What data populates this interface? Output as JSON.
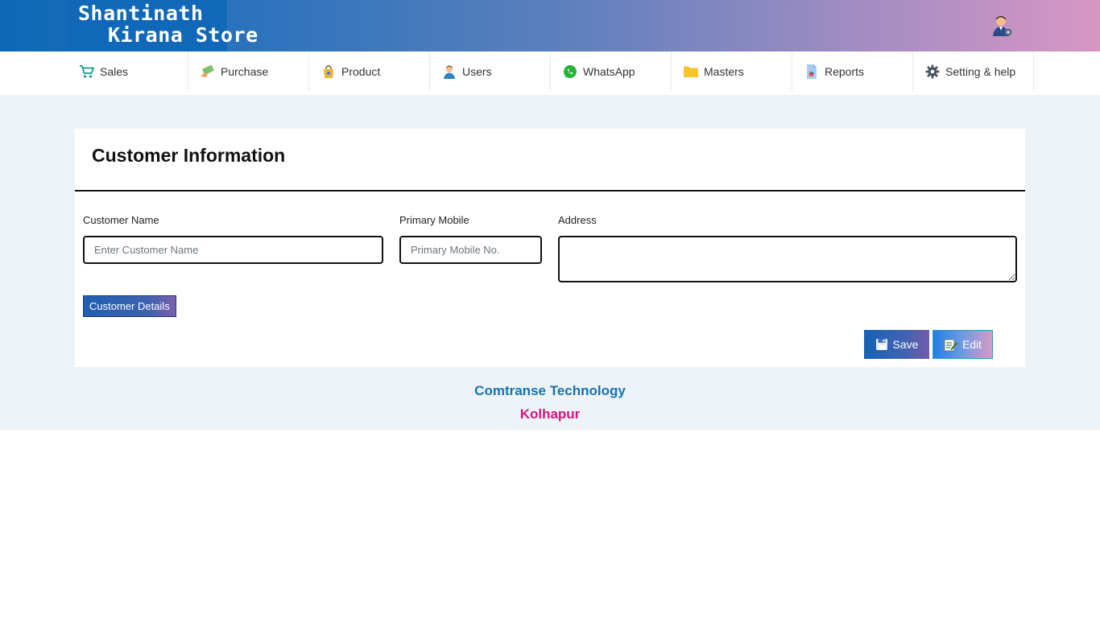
{
  "header": {
    "logo_line1": "Shantinath",
    "logo_line2": "Kirana Store",
    "user_icon": "user-avatar-icon"
  },
  "nav": {
    "items": [
      {
        "label": "Sales",
        "icon": "cart-icon"
      },
      {
        "label": "Purchase",
        "icon": "cash-icon"
      },
      {
        "label": "Product",
        "icon": "product-bag-icon"
      },
      {
        "label": "Users",
        "icon": "user-icon"
      },
      {
        "label": "WhatsApp",
        "icon": "whatsapp-icon"
      },
      {
        "label": "Masters",
        "icon": "folder-icon"
      },
      {
        "label": "Reports",
        "icon": "report-icon"
      },
      {
        "label": "Setting & help",
        "icon": "gear-icon"
      }
    ]
  },
  "form": {
    "title": "Customer Information",
    "customer_name": {
      "label": "Customer Name",
      "placeholder": "Enter Customer Name",
      "value": ""
    },
    "primary_mobile": {
      "label": "Primary Mobile",
      "placeholder": "Primary Mobile No.",
      "value": ""
    },
    "address": {
      "label": "Address",
      "value": ""
    },
    "details_button": "Customer Details",
    "save_button": "Save",
    "edit_button": "Edit"
  },
  "footer": {
    "company": "Comtranse Technology",
    "city": "Kolhapur"
  },
  "colors": {
    "primary": "#0d68b5",
    "accent_pink": "#d896c4",
    "company_text": "#1672b3",
    "city_text": "#d0157e",
    "content_bg": "#edf3f6"
  }
}
